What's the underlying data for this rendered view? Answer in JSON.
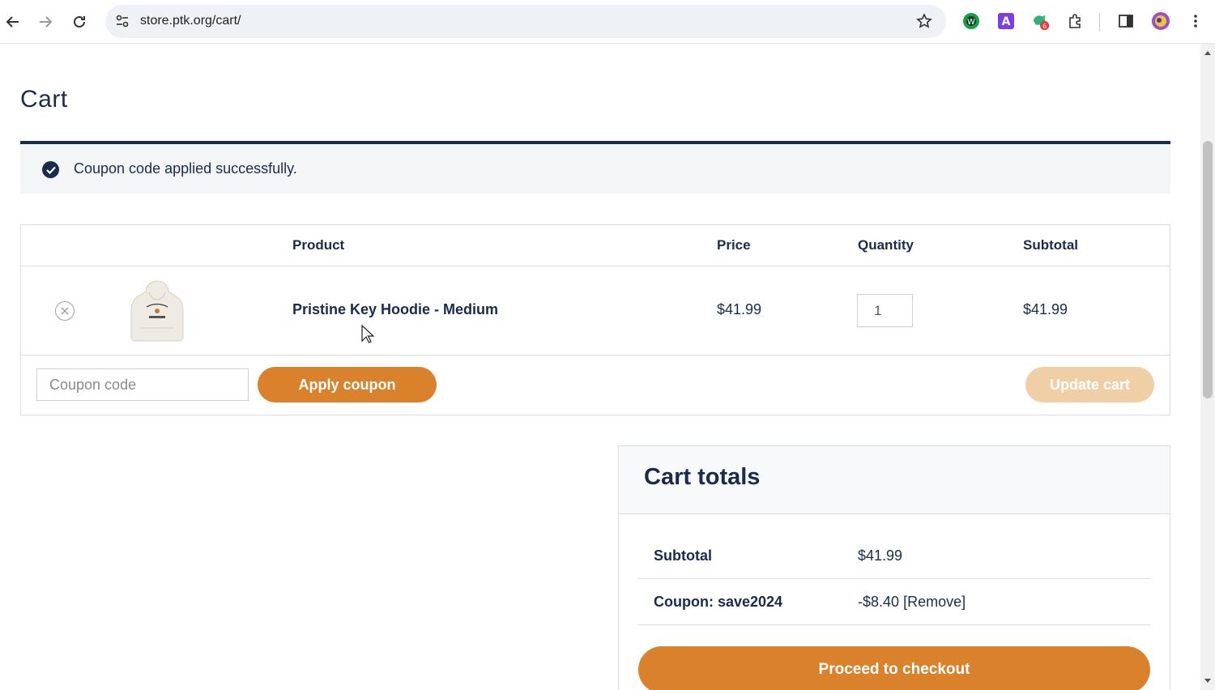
{
  "browser": {
    "url": "store.ptk.org/cart/",
    "extension_badge": "6"
  },
  "page": {
    "title": "Cart",
    "notice": "Coupon code applied successfully."
  },
  "cart": {
    "headers": {
      "product": "Product",
      "price": "Price",
      "quantity": "Quantity",
      "subtotal": "Subtotal"
    },
    "items": [
      {
        "name": "Pristine Key Hoodie - Medium",
        "price": "$41.99",
        "quantity": "1",
        "subtotal": "$41.99"
      }
    ],
    "coupon_placeholder": "Coupon code",
    "apply_coupon_label": "Apply coupon",
    "update_cart_label": "Update cart"
  },
  "totals": {
    "title": "Cart totals",
    "subtotal_label": "Subtotal",
    "subtotal_value": "$41.99",
    "coupon_label": "Coupon: save2024",
    "coupon_value": "-$8.40",
    "coupon_remove": "[Remove]",
    "checkout_label": "Proceed to checkout"
  },
  "colors": {
    "navy": "#1a2b4c",
    "accent": "#d9822b",
    "accent_disabled": "#f0cfa6"
  }
}
